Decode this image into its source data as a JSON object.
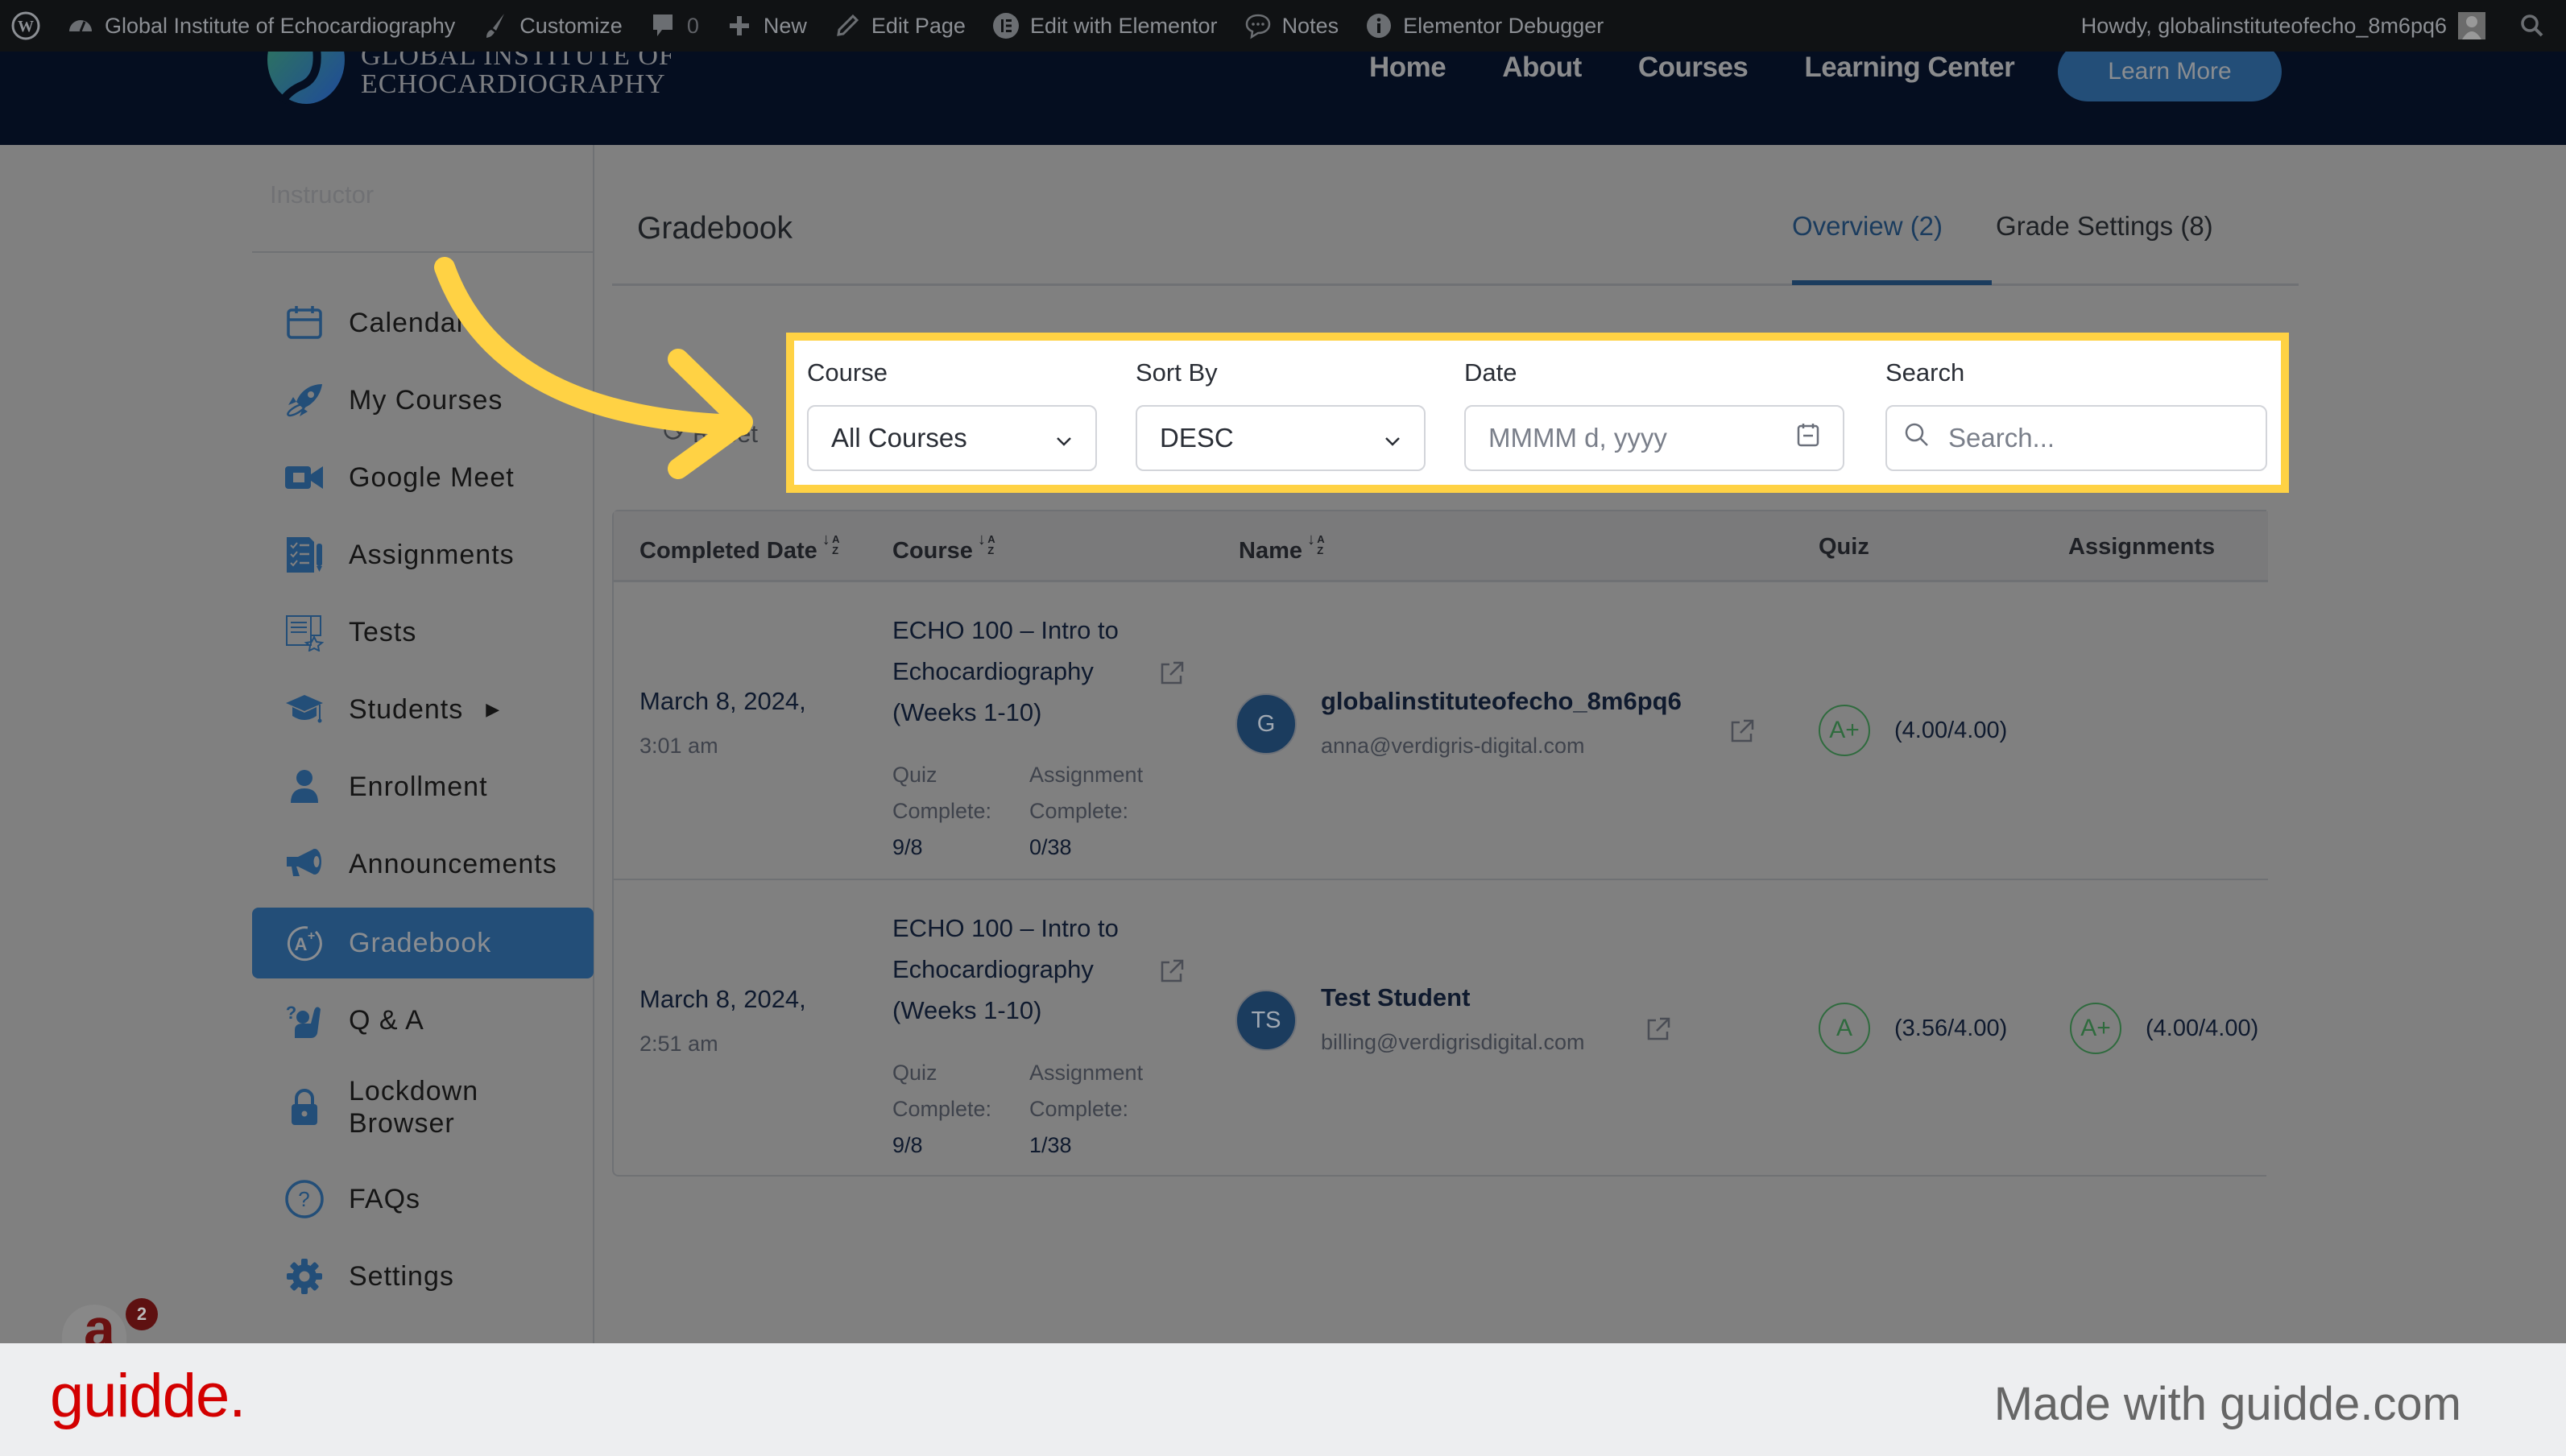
{
  "admin_bar": {
    "site_name": "Global Institute of Echocardiography",
    "customize": "Customize",
    "comments_count": "0",
    "new": "New",
    "edit_page": "Edit Page",
    "edit_with_elementor": "Edit with Elementor",
    "notes": "Notes",
    "elementor_debugger": "Elementor Debugger",
    "howdy": "Howdy, globalinstituteofecho_8m6pq6"
  },
  "site_header": {
    "logo_line1": "GLOBAL INSTITUTE OF",
    "logo_line2": "ECHOCARDIOGRAPHY",
    "nav": [
      "Home",
      "About",
      "Courses",
      "Learning Center"
    ],
    "cta": "Learn More"
  },
  "sidebar": {
    "role": "Instructor",
    "items": [
      {
        "label": "Calendar",
        "icon": "calendar-icon"
      },
      {
        "label": "My Courses",
        "icon": "rocket-icon"
      },
      {
        "label": "Google Meet",
        "icon": "video-camera-icon"
      },
      {
        "label": "Assignments",
        "icon": "assignments-checklist-icon"
      },
      {
        "label": "Tests",
        "icon": "tests-document-star-icon"
      },
      {
        "label": "Students",
        "icon": "graduation-cap-icon",
        "has_submenu": true
      },
      {
        "label": "Enrollment",
        "icon": "user-icon"
      },
      {
        "label": "Announcements",
        "icon": "megaphone-icon"
      },
      {
        "label": "Gradebook",
        "icon": "grade-a-plus-icon",
        "active": true
      },
      {
        "label": "Q & A",
        "icon": "question-raise-hand-icon"
      },
      {
        "label": "Lockdown Browser",
        "icon": "lock-icon"
      },
      {
        "label": "FAQs",
        "icon": "question-circle-icon"
      },
      {
        "label": "Settings",
        "icon": "gear-icon"
      }
    ]
  },
  "gradebook": {
    "title": "Gradebook",
    "tabs": [
      {
        "label": "Overview (2)",
        "active": true
      },
      {
        "label": "Grade Settings (8)",
        "active": false
      }
    ],
    "reset_label": "Reset",
    "filters": {
      "course": {
        "label": "Course",
        "value": "All Courses"
      },
      "sort_by": {
        "label": "Sort By",
        "value": "DESC"
      },
      "date": {
        "label": "Date",
        "placeholder": "MMMM d, yyyy"
      },
      "search": {
        "label": "Search",
        "placeholder": "Search..."
      }
    },
    "table": {
      "columns": [
        "Completed Date",
        "Course",
        "Name",
        "Quiz",
        "Assignments"
      ],
      "rows": [
        {
          "date": "March 8, 2024,",
          "time": "3:01 am",
          "course": "ECHO 100 – Intro to Echocardiography (Weeks 1-10)",
          "quiz_complete_label": "Quiz Complete:",
          "quiz_complete": "9/8",
          "assignment_complete_label": "Assignment Complete:",
          "assignment_complete": "0/38",
          "avatar_initials": "G",
          "name": "globalinstituteofecho_8m6pq6",
          "email": "anna@verdigris-digital.com",
          "quiz_grade": "A+",
          "quiz_score": "(4.00/4.00)",
          "assignment_grade": "",
          "assignment_score": ""
        },
        {
          "date": "March 8, 2024,",
          "time": "2:51 am",
          "course": "ECHO 100 – Intro to Echocardiography (Weeks 1-10)",
          "quiz_complete_label": "Quiz Complete:",
          "quiz_complete": "9/8",
          "assignment_complete_label": "Assignment Complete:",
          "assignment_complete": "1/38",
          "avatar_initials": "TS",
          "name": "Test Student",
          "email": "billing@verdigrisdigital.com",
          "quiz_grade": "A",
          "quiz_score": "(3.56/4.00)",
          "assignment_grade": "A+",
          "assignment_score": "(4.00/4.00)"
        }
      ]
    }
  },
  "widget": {
    "letter": "a",
    "badge_count": "2"
  },
  "footer": {
    "brand": "guidde.",
    "made_with": "Made with guidde.com"
  },
  "colors": {
    "accent": "#234e78",
    "highlight": "#ffd244",
    "grade_green": "#2f6b3e",
    "guidde_red": "#d30000"
  }
}
